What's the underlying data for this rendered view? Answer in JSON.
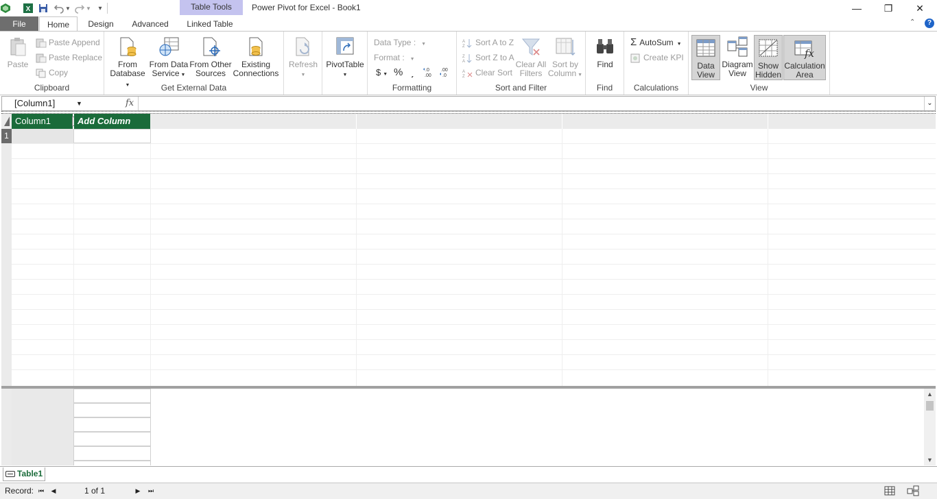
{
  "app": {
    "title": "Power Pivot for Excel - Book1",
    "context_tab": "Table Tools"
  },
  "window_controls": {
    "minimize": "—",
    "restore": "❐",
    "close": "✕"
  },
  "tabs": {
    "file": "File",
    "items": [
      "Home",
      "Design",
      "Advanced",
      "Linked Table"
    ],
    "active": "Home"
  },
  "ribbon": {
    "clipboard": {
      "label": "Clipboard",
      "paste": "Paste",
      "paste_append": "Paste Append",
      "paste_replace": "Paste Replace",
      "copy": "Copy"
    },
    "external": {
      "label": "Get External Data",
      "from_database_1": "From",
      "from_database_2": "Database",
      "from_service_1": "From Data",
      "from_service_2": "Service",
      "other_sources_1": "From Other",
      "other_sources_2": "Sources",
      "existing_1": "Existing",
      "existing_2": "Connections"
    },
    "refresh": {
      "label": "Refresh"
    },
    "pivot": {
      "label": "PivotTable"
    },
    "formatting": {
      "label": "Formatting",
      "data_type": "Data Type :",
      "format": "Format :",
      "currency": "$",
      "percent": "%",
      "comma": "͵",
      "inc_decimal": "←.0 .00",
      "dec_decimal": ".00 →.0"
    },
    "sort_filter": {
      "label": "Sort and Filter",
      "sort_az": "Sort A to Z",
      "sort_za": "Sort Z to A",
      "clear_sort": "Clear Sort",
      "clear_filters_1": "Clear All",
      "clear_filters_2": "Filters",
      "sort_by_column_1": "Sort by",
      "sort_by_column_2": "Column"
    },
    "find": {
      "label": "Find",
      "button": "Find"
    },
    "calculations": {
      "label": "Calculations",
      "autosum": "AutoSum",
      "create_kpi": "Create KPI"
    },
    "view": {
      "label": "View",
      "data_view_1": "Data",
      "data_view_2": "View",
      "diagram_view_1": "Diagram",
      "diagram_view_2": "View",
      "show_hidden_1": "Show",
      "show_hidden_2": "Hidden",
      "calc_area_1": "Calculation",
      "calc_area_2": "Area"
    }
  },
  "formula_bar": {
    "name_box": "[Column1]",
    "fx": "fx",
    "formula": ""
  },
  "grid": {
    "columns": [
      "Column1",
      "Add Column"
    ],
    "row_numbers": [
      "1"
    ]
  },
  "sheet_tabs": [
    "Table1"
  ],
  "status": {
    "record_label": "Record:",
    "record_count": "1 of 1"
  },
  "colors": {
    "header_green": "#1a6b3a",
    "context_tab": "#c4c3ef",
    "file_tab": "#6e6e6e"
  }
}
